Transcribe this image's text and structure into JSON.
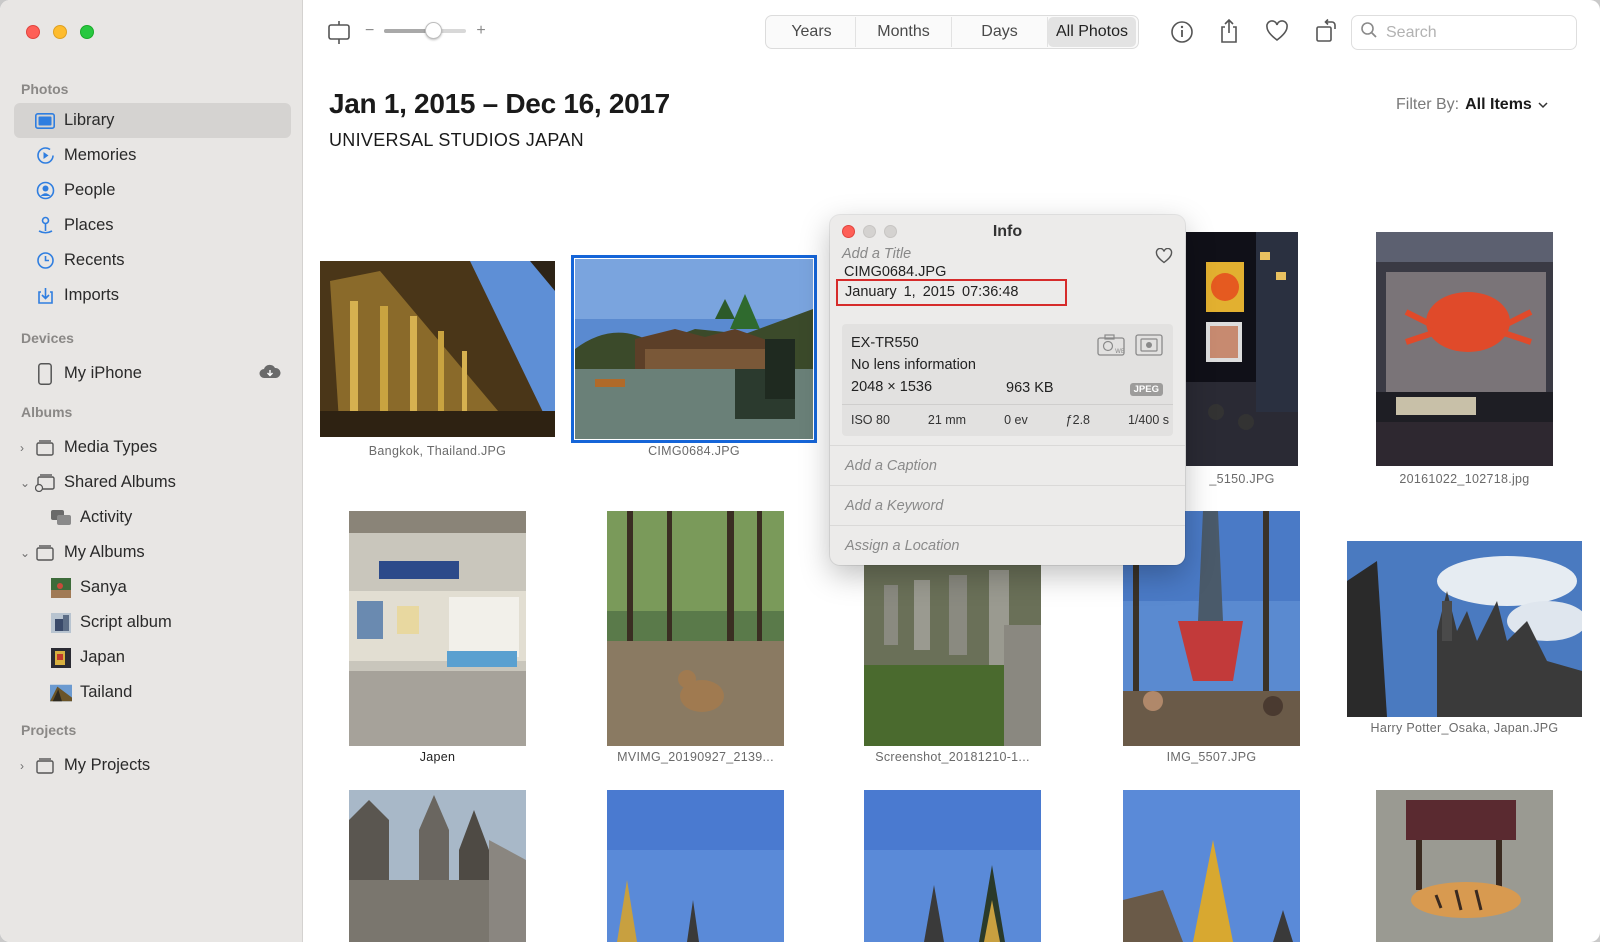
{
  "window": {
    "traffic": [
      "close",
      "minimize",
      "zoom"
    ]
  },
  "sidebar": {
    "sections": {
      "photos": "Photos",
      "devices": "Devices",
      "albums": "Albums",
      "projects": "Projects"
    },
    "photos_items": [
      {
        "label": "Library",
        "icon": "library-icon",
        "active": true
      },
      {
        "label": "Memories",
        "icon": "memories-icon"
      },
      {
        "label": "People",
        "icon": "people-icon"
      },
      {
        "label": "Places",
        "icon": "places-icon"
      },
      {
        "label": "Recents",
        "icon": "recents-icon"
      },
      {
        "label": "Imports",
        "icon": "imports-icon"
      }
    ],
    "devices_items": [
      {
        "label": "My iPhone",
        "icon": "iphone-icon",
        "badge_icon": "cloud-icon"
      }
    ],
    "album_items": [
      {
        "label": "Media Types",
        "icon": "folder-icon",
        "chevron": "›"
      },
      {
        "label": "Shared Albums",
        "icon": "shared-folder-icon",
        "chevron": "⌄"
      },
      {
        "label": "Activity",
        "icon": "activity-icon"
      },
      {
        "label": "My Albums",
        "icon": "folder-icon",
        "chevron": "⌄"
      },
      {
        "label": "Sanya",
        "icon": "album-thumb-icon"
      },
      {
        "label": "Script album",
        "icon": "album-thumb-icon"
      },
      {
        "label": "Japan",
        "icon": "album-thumb-icon"
      },
      {
        "label": "Tailand",
        "icon": "album-thumb-icon"
      }
    ],
    "project_items": [
      {
        "label": "My Projects",
        "icon": "folder-icon",
        "chevron": "›"
      }
    ]
  },
  "toolbar": {
    "zoom_minus": "−",
    "zoom_plus": "+",
    "zoom_level": 0.6,
    "segments": [
      "Years",
      "Months",
      "Days",
      "All Photos"
    ],
    "selected_segment": "All Photos",
    "search_placeholder": "Search"
  },
  "header": {
    "date_range": "Jan 1, 2015 – Dec 16, 2017",
    "location": "UNIVERSAL STUDIOS JAPAN",
    "filter_label": "Filter By:",
    "filter_value": "All Items"
  },
  "photos": [
    {
      "caption": "Bangkok, Thailand.JPG",
      "scene": "temple"
    },
    {
      "caption": "CIMG0684.JPG",
      "scene": "water-village",
      "selected": true
    },
    {
      "caption": "_5150.JPG",
      "scene": "night-street"
    },
    {
      "caption": "20161022_102718.jpg",
      "scene": "crab-sign"
    },
    {
      "caption": "Japen",
      "scene": "station"
    },
    {
      "caption": "MVIMG_20190927_2139...",
      "scene": "deer-forest"
    },
    {
      "caption": "Screenshot_20181210-1...",
      "scene": "lanterns"
    },
    {
      "caption": "IMG_5507.JPG",
      "scene": "ride"
    },
    {
      "caption": "Harry Potter_Osaka, Japan.JPG",
      "scene": "castle"
    },
    {
      "caption": "",
      "scene": "castle-close"
    },
    {
      "caption": "",
      "scene": "stupa-sky"
    },
    {
      "caption": "",
      "scene": "stupa-sky-2"
    },
    {
      "caption": "",
      "scene": "stupa-gold"
    },
    {
      "caption": "",
      "scene": "tiger"
    }
  ],
  "info": {
    "title": "Info",
    "add_title_placeholder": "Add a Title",
    "filename": "CIMG0684.JPG",
    "datetime": "January 1, 2015   07:36:48",
    "camera": {
      "model": "EX-TR550",
      "lens": "No lens information",
      "dimensions": "2048 × 1536",
      "filesize": "963 KB",
      "format": "JPEG",
      "iso": "ISO 80",
      "focal": "21 mm",
      "ev": "0 ev",
      "aperture": "ƒ2.8",
      "shutter": "1/400 s"
    },
    "caption_placeholder": "Add a Caption",
    "keyword_placeholder": "Add a Keyword",
    "location_placeholder": "Assign a Location"
  },
  "colors": {
    "accent": "#1565d8",
    "sidebar_bg": "#e8e6e4",
    "highlight_box": "#d62b2b"
  }
}
